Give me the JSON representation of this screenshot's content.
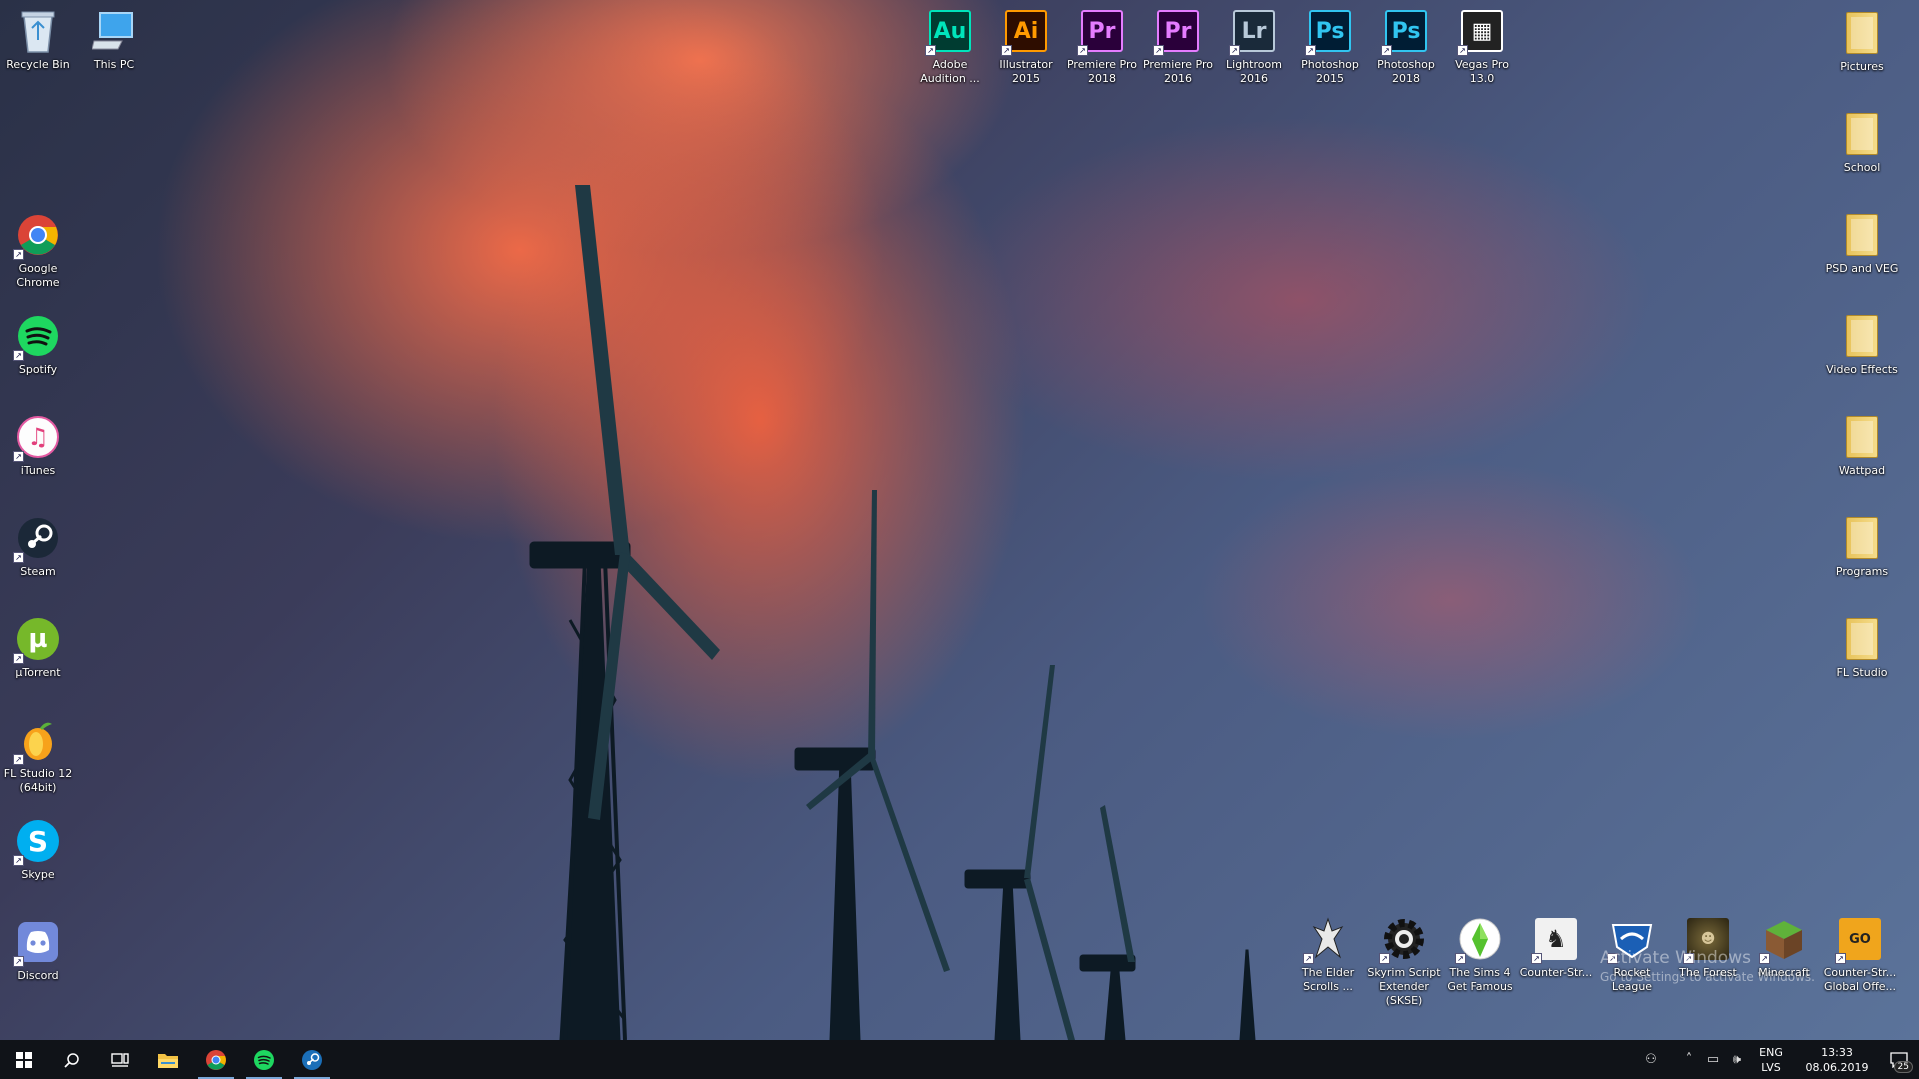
{
  "desktop": {
    "top_icons": [
      {
        "label": "Recycle Bin",
        "icon": "recycle-bin-icon"
      },
      {
        "label": "This PC",
        "icon": "this-pc-icon"
      }
    ],
    "left_icons": [
      {
        "label": "Google Chrome",
        "icon": "chrome-icon"
      },
      {
        "label": "Spotify",
        "icon": "spotify-icon"
      },
      {
        "label": "iTunes",
        "icon": "itunes-icon"
      },
      {
        "label": "Steam",
        "icon": "steam-icon"
      },
      {
        "label": "µTorrent",
        "icon": "utorrent-icon"
      },
      {
        "label": "FL Studio 12 (64bit)",
        "icon": "fl-studio-icon"
      },
      {
        "label": "Skype",
        "icon": "skype-icon"
      },
      {
        "label": "Discord",
        "icon": "discord-icon"
      }
    ],
    "adobe_icons": [
      {
        "label": "Adobe Audition ...",
        "abbr": "Au",
        "fg": "#00e4bb",
        "bg": "#003c31"
      },
      {
        "label": "Illustrator 2015",
        "abbr": "Ai",
        "fg": "#ff9a00",
        "bg": "#2e0d00"
      },
      {
        "label": "Premiere Pro 2018",
        "abbr": "Pr",
        "fg": "#e57cff",
        "bg": "#2a003a"
      },
      {
        "label": "Premiere Pro 2016",
        "abbr": "Pr",
        "fg": "#e57cff",
        "bg": "#2a003a"
      },
      {
        "label": "Lightroom 2016",
        "abbr": "Lr",
        "fg": "#b8c9d9",
        "bg": "#1a2a3a"
      },
      {
        "label": "Photoshop 2015",
        "abbr": "Ps",
        "fg": "#31c5f0",
        "bg": "#001d34"
      },
      {
        "label": "Photoshop 2018",
        "abbr": "Ps",
        "fg": "#31c5f0",
        "bg": "#001d34"
      },
      {
        "label": "Vegas Pro 13.0",
        "abbr": "▦",
        "fg": "#ffffff",
        "bg": "#222"
      }
    ],
    "right_folders": [
      {
        "label": "Pictures"
      },
      {
        "label": "School"
      },
      {
        "label": "PSD and VEG"
      },
      {
        "label": "Video Effects"
      },
      {
        "label": "Wattpad"
      },
      {
        "label": "Programs"
      },
      {
        "label": "FL Studio"
      }
    ],
    "bottom_icons": [
      {
        "label": "The Elder Scrolls ...",
        "icon": "skyrim-icon"
      },
      {
        "label": "Skyrim Script Extender (SKSE)",
        "icon": "gear-icon"
      },
      {
        "label": "The Sims 4 Get Famous",
        "icon": "sims-icon"
      },
      {
        "label": "Counter-Str...",
        "icon": "counter-strike-icon"
      },
      {
        "label": "Rocket League",
        "icon": "rocket-league-icon"
      },
      {
        "label": "The Forest",
        "icon": "the-forest-icon"
      },
      {
        "label": "Minecraft",
        "icon": "minecraft-icon"
      },
      {
        "label": "Counter-Str... Global Offe...",
        "icon": "csgo-icon"
      }
    ],
    "watermark": {
      "title": "Activate Windows",
      "subtitle": "Go to Settings to activate Windows."
    }
  },
  "taskbar": {
    "buttons": [
      {
        "name": "start-button",
        "icon": "windows-icon"
      },
      {
        "name": "search-button",
        "icon": "search-icon"
      },
      {
        "name": "task-view-button",
        "icon": "task-view-icon"
      },
      {
        "name": "file-explorer-button",
        "icon": "folder-icon"
      },
      {
        "name": "chrome-taskbar-button",
        "icon": "chrome-icon"
      },
      {
        "name": "spotify-taskbar-button",
        "icon": "spotify-icon"
      },
      {
        "name": "steam-taskbar-button",
        "icon": "steam-icon"
      }
    ],
    "tray": {
      "language": "ENG",
      "layout": "LVS",
      "time": "13:33",
      "date": "08.06.2019",
      "notifications": "25"
    }
  }
}
